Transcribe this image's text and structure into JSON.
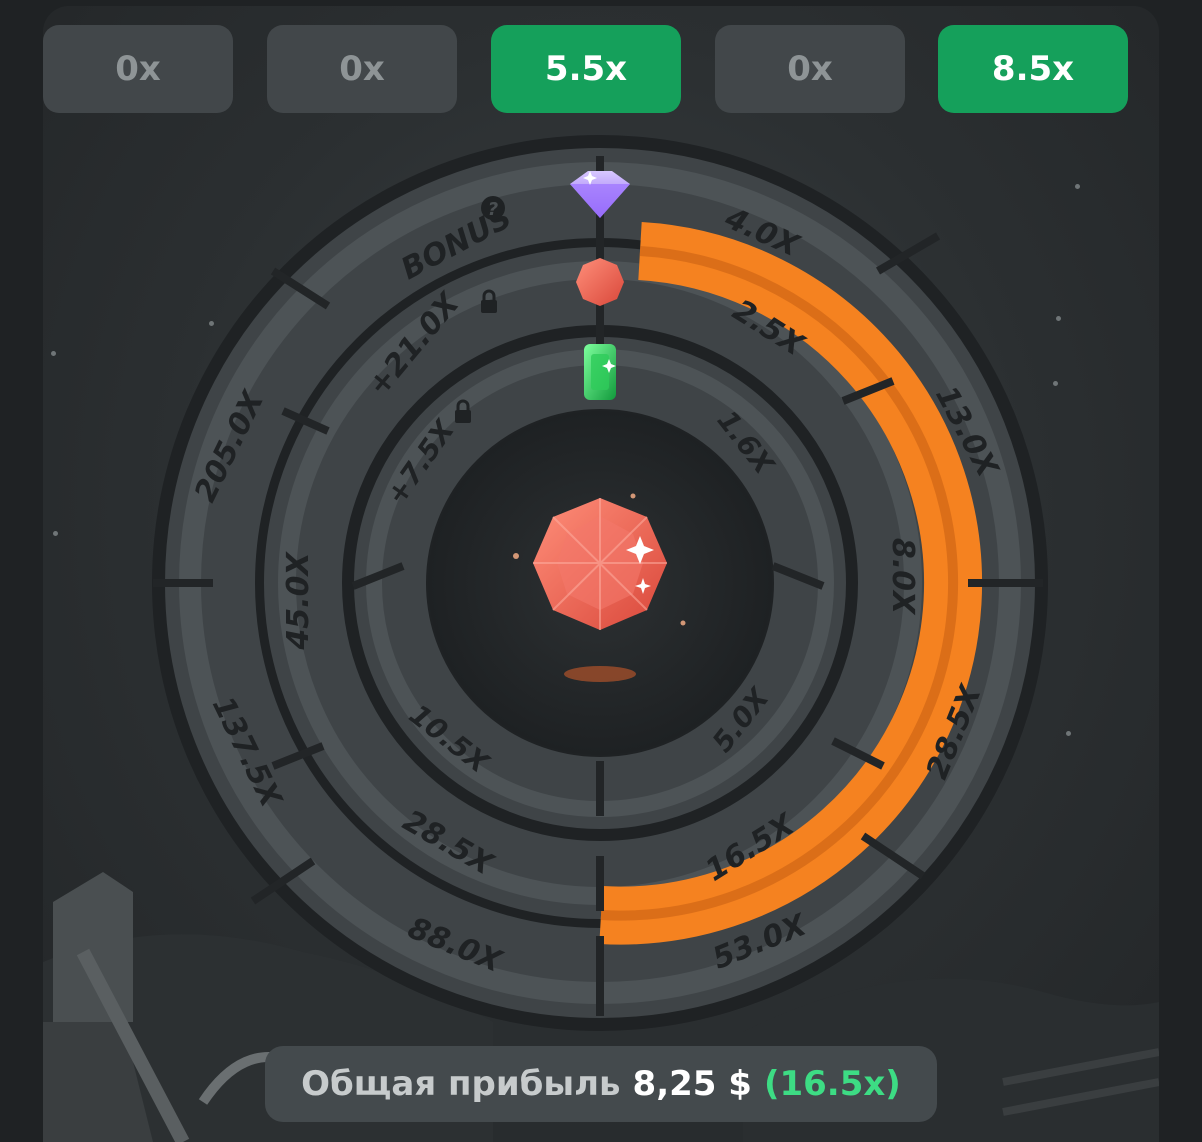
{
  "history": [
    {
      "label": "0x",
      "win": false
    },
    {
      "label": "0x",
      "win": false
    },
    {
      "label": "5.5x",
      "win": true
    },
    {
      "label": "0x",
      "win": false
    },
    {
      "label": "8.5x",
      "win": true
    }
  ],
  "wheel": {
    "outer_ring": {
      "gem": "purple-diamond-icon",
      "bonus_label": "BONUS",
      "segments": [
        "4.0X",
        "13.0X",
        "28.5X",
        "53.0X",
        "88.0X",
        "137.5X",
        "205.0X"
      ]
    },
    "middle_ring": {
      "gem": "red-gem-icon",
      "locked_label": "+21.0X",
      "segments": [
        "2.5X",
        "8.0X",
        "16.5X",
        "28.5X",
        "45.0X"
      ]
    },
    "inner_ring": {
      "gem": "green-emerald-icon",
      "locked_label": "+7.5X",
      "segments": [
        "1.6X",
        "5.0X",
        "10.5X"
      ]
    },
    "highlight_color": "#f58220",
    "center_gem": "red-octagon-gem-icon"
  },
  "profit": {
    "label": "Общая прибыль",
    "amount": "8,25 $",
    "multiplier": "(16.5x)"
  }
}
